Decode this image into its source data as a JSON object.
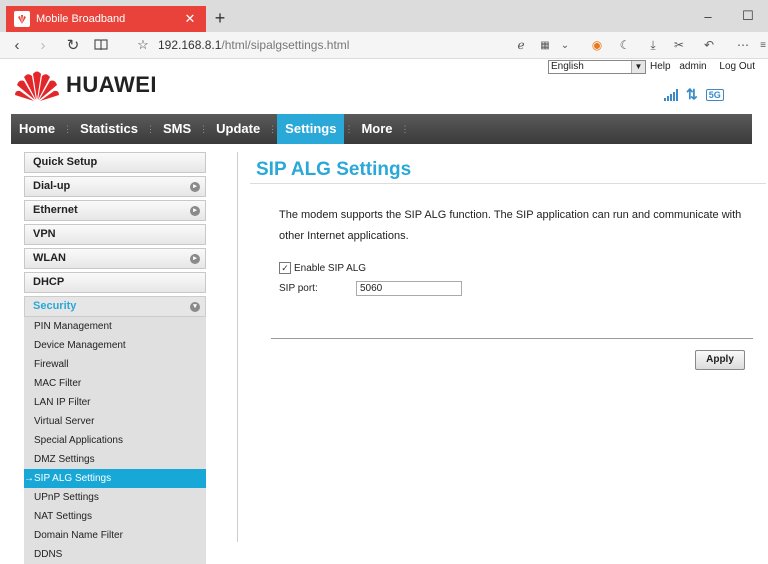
{
  "browser": {
    "tab_title": "Mobile Broadband",
    "new_tab": "+",
    "url_host": "192.168.8.1",
    "url_path": "/html/sipalgsettings.html",
    "window_controls": [
      "–",
      "☐"
    ]
  },
  "header": {
    "language": "English",
    "links": [
      "Help",
      "admin",
      "Log Out"
    ],
    "logo_text": "HUAWEI",
    "network_badge": "5G"
  },
  "nav": {
    "items": [
      "Home",
      "Statistics",
      "SMS",
      "Update",
      "Settings",
      "More"
    ],
    "active": "Settings"
  },
  "sidebar": {
    "sections": [
      "Quick Setup",
      "Dial-up",
      "Ethernet",
      "VPN",
      "WLAN",
      "DHCP"
    ],
    "open_section": "Security",
    "security_items": [
      "PIN Management",
      "Device Management",
      "Firewall",
      "MAC Filter",
      "LAN IP Filter",
      "Virtual Server",
      "Special Applications",
      "DMZ Settings",
      "→SIP ALG Settings",
      "UPnP Settings",
      "NAT Settings",
      "Domain Name Filter",
      "DDNS"
    ]
  },
  "content": {
    "title": "SIP ALG Settings",
    "description": "The modem supports the SIP ALG function. The SIP application can run and communicate with other Internet applications.",
    "enable_label": "Enable SIP ALG",
    "port_label": "SIP port:",
    "port_value": "5060",
    "apply_label": "Apply"
  },
  "colors": {
    "accent": "#2aa8d8",
    "tab_red": "#e8423a",
    "nav_dark": "#4a4a4a"
  }
}
